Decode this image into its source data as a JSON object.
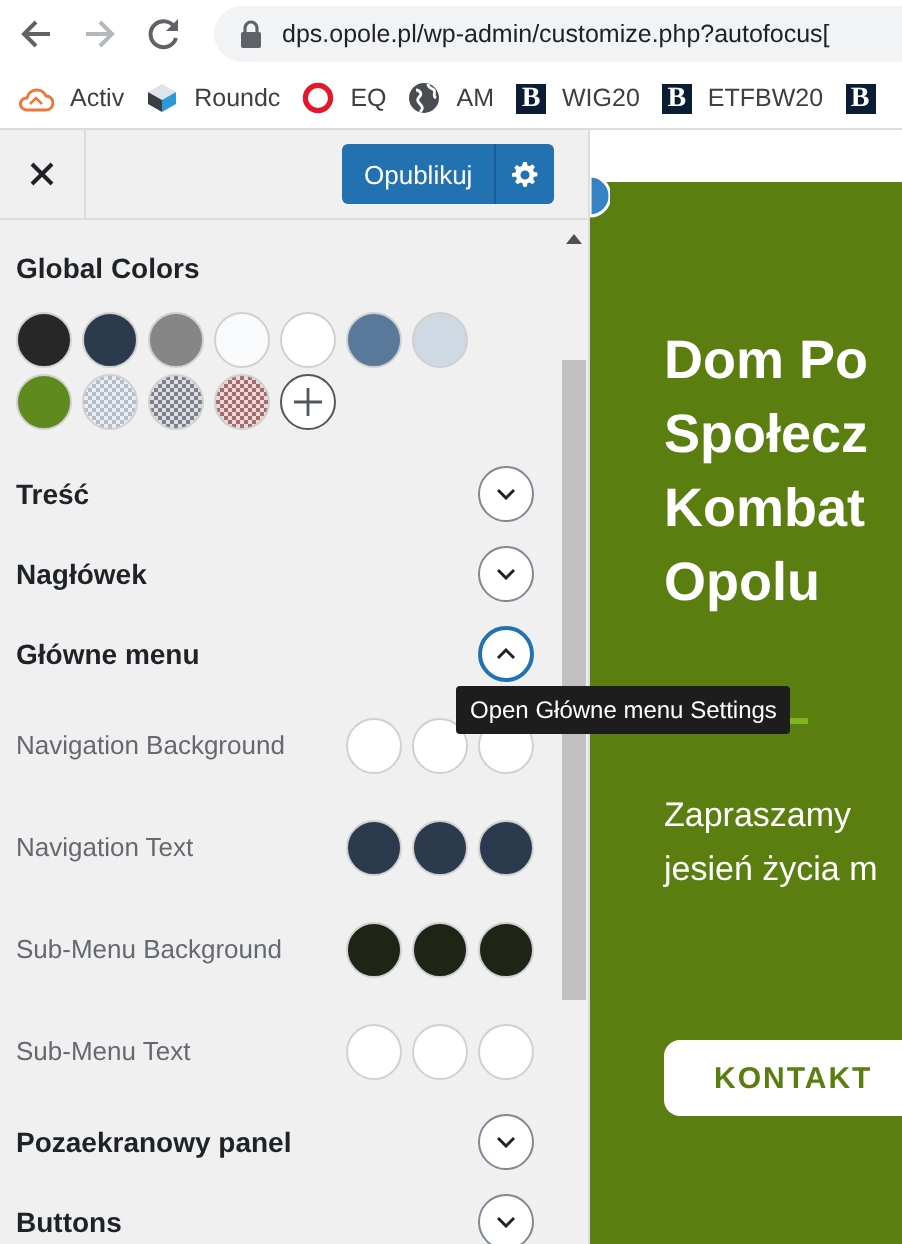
{
  "browser": {
    "address": "dps.opole.pl/wp-admin/customize.php?autofocus[",
    "bookmarks": [
      {
        "kind": "cloud",
        "label": "Activ"
      },
      {
        "kind": "cube",
        "label": "Roundc"
      },
      {
        "kind": "ring",
        "label": "EQ"
      },
      {
        "kind": "globe",
        "label": "AM"
      },
      {
        "kind": "letter",
        "icon_text": "B",
        "label": "WIG20"
      },
      {
        "kind": "letter",
        "icon_text": "B",
        "label": "ETFBW20"
      },
      {
        "kind": "letter",
        "icon_text": "B"
      }
    ]
  },
  "customizer": {
    "publish_button": "Opublikuj",
    "global_colors": {
      "title": "Global Colors",
      "swatches": [
        {
          "kind": "solid",
          "color": "#272727"
        },
        {
          "kind": "solid",
          "color": "#2b3a4c"
        },
        {
          "kind": "solid",
          "color": "#868686"
        },
        {
          "kind": "solid",
          "color": "#f9fafb"
        },
        {
          "kind": "solid",
          "color": "#ffffff"
        },
        {
          "kind": "solid",
          "color": "#5a7899"
        },
        {
          "kind": "solid",
          "color": "#cfd9e4"
        },
        {
          "kind": "solid",
          "color": "#5f8a1e"
        },
        {
          "kind": "transparent",
          "color": "#b4bccb"
        },
        {
          "kind": "transparent",
          "color": "#7c818b"
        },
        {
          "kind": "transparent",
          "color": "#a86b6b"
        },
        {
          "kind": "add"
        }
      ]
    },
    "sections": [
      {
        "kind": "section",
        "label": "Treść",
        "expanded": false
      },
      {
        "kind": "section",
        "label": "Nagłówek",
        "expanded": false
      },
      {
        "kind": "section",
        "label": "Główne menu",
        "expanded": true
      },
      {
        "kind": "color",
        "label": "Navigation Background",
        "swatches": [
          {
            "color": "#ffffff"
          },
          {
            "color": "#ffffff"
          },
          {
            "color": "#ffffff"
          }
        ]
      },
      {
        "kind": "color",
        "label": "Navigation Text",
        "swatches": [
          {
            "color": "#2b3a4c"
          },
          {
            "color": "#2b3a4c"
          },
          {
            "color": "#2b3a4c"
          }
        ]
      },
      {
        "kind": "color",
        "label": "Sub-Menu Background",
        "swatches": [
          {
            "color": "#1e2416"
          },
          {
            "color": "#1e2416"
          },
          {
            "color": "#1e2416"
          }
        ]
      },
      {
        "kind": "color",
        "label": "Sub-Menu Text",
        "swatches": [
          {
            "color": "#ffffff"
          },
          {
            "color": "#ffffff"
          },
          {
            "color": "#ffffff"
          }
        ]
      },
      {
        "kind": "section",
        "label": "Pozaekranowy panel",
        "expanded": false
      },
      {
        "kind": "section",
        "label": "Buttons",
        "expanded": false
      }
    ],
    "tooltip": "Open Główne menu Settings"
  },
  "preview": {
    "heading_lines": [
      "Dom Po",
      "Społecz",
      "Kombat",
      "Opolu"
    ],
    "text_lines": [
      "Zapraszamy",
      "jesień życia m"
    ],
    "button": "KONTAKT"
  }
}
